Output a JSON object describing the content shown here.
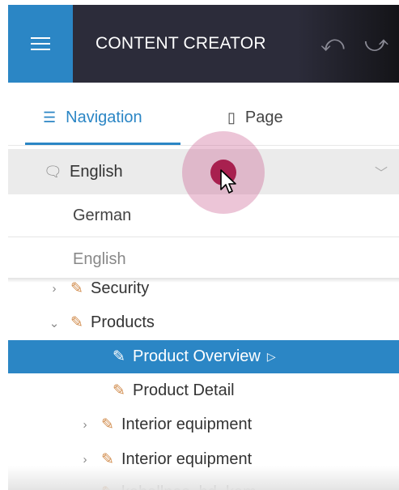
{
  "header": {
    "menu_icon": "hamburger-icon",
    "title": "CONTENT CREATOR",
    "undo_icon": "undo-icon",
    "redo_icon": "redo-icon"
  },
  "tabs": [
    {
      "label": "Navigation",
      "icon": "list-icon",
      "active": true
    },
    {
      "label": "Page",
      "icon": "page-icon",
      "active": false
    }
  ],
  "language_select": {
    "icon": "speech-bubble-icon",
    "value": "English",
    "options": [
      "German",
      "English"
    ]
  },
  "tree": {
    "items": [
      {
        "label": "Security",
        "expanded": false,
        "level": 1
      },
      {
        "label": "Products",
        "expanded": true,
        "level": 1
      },
      {
        "label": "Product Overview",
        "selected": true,
        "level": 2
      },
      {
        "label": "Product Detail",
        "level": 2
      },
      {
        "label": "Interior equipment",
        "expanded": false,
        "level": 2
      },
      {
        "label": "Interior equipment",
        "expanded": false,
        "level": 2
      },
      {
        "label": "kaballnes_bd_kam",
        "level": 2
      }
    ]
  },
  "colors": {
    "accent": "#2b86c5",
    "header_bg": "#2c2c3a",
    "pencil": "#d08a4a",
    "click_indicator": "#a8204f"
  }
}
